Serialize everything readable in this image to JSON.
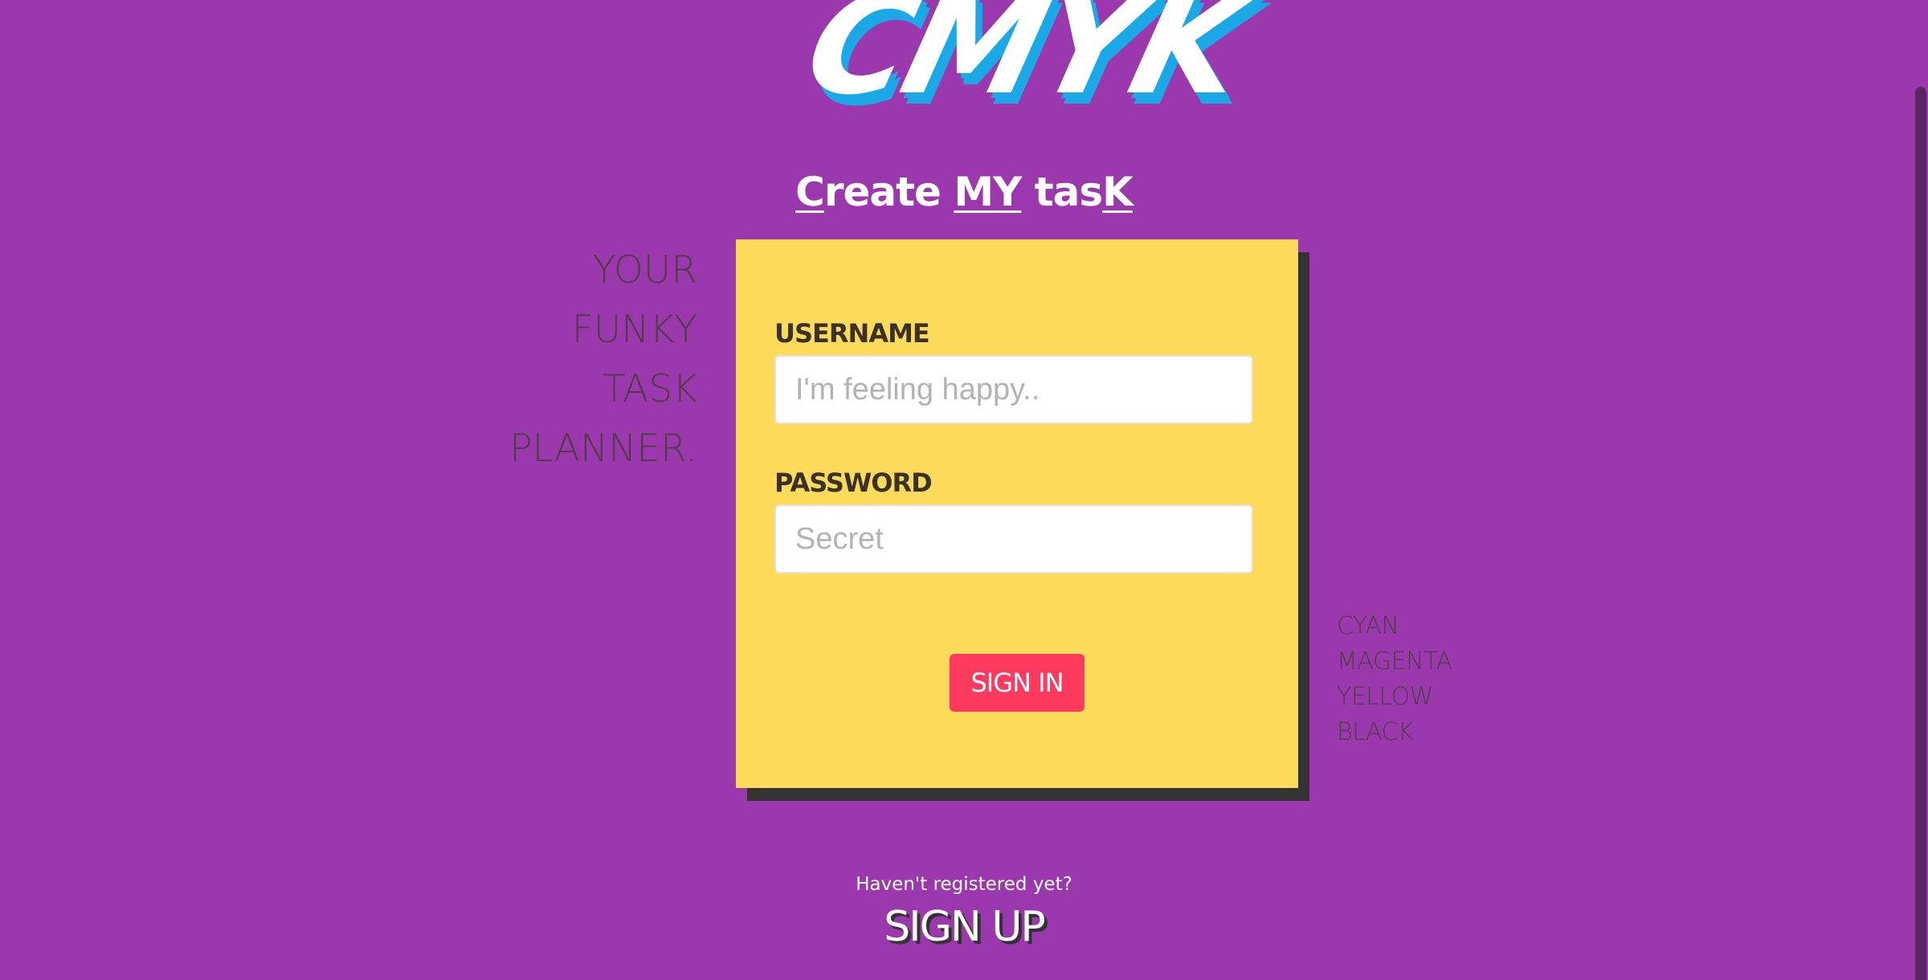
{
  "brand": {
    "logo_text": "CMYK",
    "tagline": {
      "part1_u": "C",
      "part1_rest": "reate ",
      "part2_u": "MY",
      "part3_rest": " tas",
      "part3_u": "K"
    }
  },
  "description": [
    "YOUR",
    "FUNKY",
    "TASK",
    "PLANNER."
  ],
  "login_form": {
    "username_label": "USERNAME",
    "username_placeholder": "I'm feeling happy..",
    "username_value": "",
    "password_label": "PASSWORD",
    "password_placeholder": "Secret",
    "password_value": "",
    "submit_label": "SIGN IN"
  },
  "color_list": [
    "CYAN",
    "MAGENTA",
    "YELLOW",
    "BLACK"
  ],
  "signup": {
    "hint": "Haven't registered yet?",
    "link_label": "SIGN UP"
  },
  "colors": {
    "background": "#9c38ad",
    "card": "#fcdb5b",
    "card_shadow": "#333333",
    "button": "#ff3a5f",
    "logo_shadow": "#1ba8e6"
  }
}
